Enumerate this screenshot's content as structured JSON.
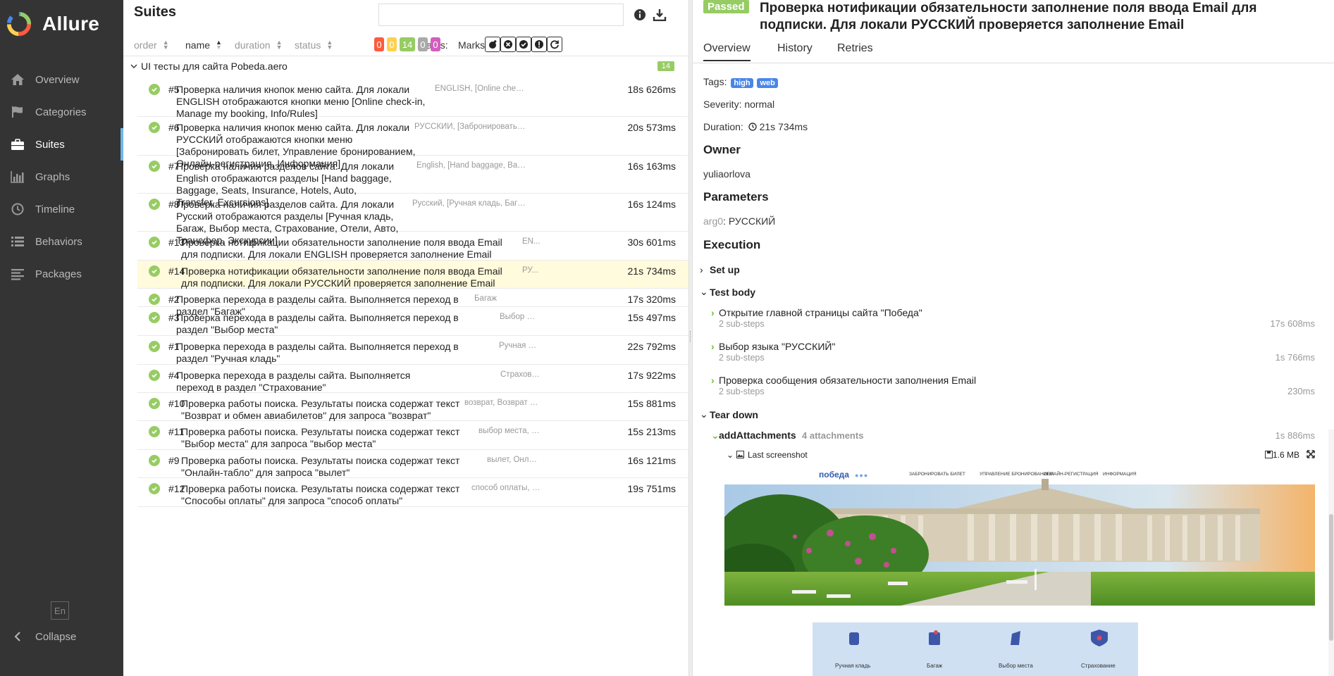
{
  "app": {
    "name": "Allure"
  },
  "sidebar": {
    "items": [
      {
        "label": "Overview",
        "icon": "home-icon"
      },
      {
        "label": "Categories",
        "icon": "flag-icon"
      },
      {
        "label": "Suites",
        "icon": "briefcase-icon",
        "active": true
      },
      {
        "label": "Graphs",
        "icon": "bar-chart-icon"
      },
      {
        "label": "Timeline",
        "icon": "clock-icon"
      },
      {
        "label": "Behaviors",
        "icon": "list-icon"
      },
      {
        "label": "Packages",
        "icon": "align-left-icon"
      }
    ],
    "lang": "En",
    "collapse": "Collapse"
  },
  "suites": {
    "title": "Suites",
    "sort": {
      "order": "order",
      "name": "name",
      "duration": "duration",
      "status": "status"
    },
    "status_label": "Status:",
    "status_counts": [
      {
        "value": "0",
        "color": "#fd5a3e"
      },
      {
        "value": "0",
        "color": "#ffd050"
      },
      {
        "value": "14",
        "color": "#97cc64"
      },
      {
        "value": "0",
        "color": "#aaaaaa"
      },
      {
        "value": "0",
        "color": "#d35ebe"
      }
    ],
    "marks_label": "Marks:",
    "group": {
      "name": "UI тесты для сайта Pobeda.aero",
      "count": "14"
    },
    "tests": [
      {
        "num": "#5",
        "name": "Проверка наличия кнопок меню сайта. Для локали ENGLISH отображаются кнопки меню [Online check-in, Manage my booking, Info/Rules]",
        "params": "ENGLISH, [Online check-in,...",
        "duration": "18s 626ms"
      },
      {
        "num": "#6",
        "name": "Проверка наличия кнопок меню сайта. Для локали РУССКИЙ отображаются кнопки меню [Забронировать билет, Управление бронированием, Онлайн-регистрация, Информация]",
        "params": "РУССКИЙ, [Забронировать биле...",
        "duration": "20s 573ms"
      },
      {
        "num": "#7",
        "name": "Проверка наличия разделов сайта. Для локали English отображаются разделы [Hand baggage, Baggage, Seats, Insurance, Hotels, Auto, Transfer, Excursions]",
        "params": "English, [Hand baggage, Baggag...",
        "duration": "16s 163ms"
      },
      {
        "num": "#8",
        "name": "Проверка наличия разделов сайта. Для локали Русский отображаются разделы [Ручная кладь, Багаж, Выбор места, Страхование, Отели, Авто, Трансфер, Экскурсии]",
        "params": "Русский, [Ручная кладь, Багаж, В...",
        "duration": "16s 124ms"
      },
      {
        "num": "#13",
        "name": "Проверка нотификации обязательности заполнение поля ввода Email для подписки. Для локали ENGLISH проверяется заполнение Email",
        "params": "EN...",
        "duration": "30s 601ms"
      },
      {
        "num": "#14",
        "name": "Проверка нотификации обязательности заполнение поля ввода Email для подписки. Для локали РУССКИЙ проверяется заполнение Email",
        "params": "РУ...",
        "duration": "21s 734ms",
        "selected": true
      },
      {
        "num": "#2",
        "name": "Проверка перехода в разделы сайта. Выполняется переход в раздел \"Багаж\"",
        "params": "Багаж",
        "duration": "17s 320ms"
      },
      {
        "num": "#3",
        "name": "Проверка перехода в разделы сайта. Выполняется переход в раздел \"Выбор места\"",
        "params": "Выбор ме...",
        "duration": "15s 497ms"
      },
      {
        "num": "#1",
        "name": "Проверка перехода в разделы сайта. Выполняется переход в раздел \"Ручная кладь\"",
        "params": "Ручная кла...",
        "duration": "22s 792ms"
      },
      {
        "num": "#4",
        "name": "Проверка перехода в разделы сайта. Выполняется переход в раздел \"Страхование\"",
        "params": "Страхован...",
        "duration": "17s 922ms"
      },
      {
        "num": "#10",
        "name": "Проверка работы поиска. Результаты поиска содержат текст \"Возврат и обмен авиабилетов\" для запроса \"возврат\"",
        "params": "возврат, Возврат и об...",
        "duration": "15s 881ms"
      },
      {
        "num": "#11",
        "name": "Проверка работы поиска. Результаты поиска содержат текст \"Выбор места\" для запроса \"выбор места\"",
        "params": "выбор места, Вы...",
        "duration": "15s 213ms"
      },
      {
        "num": "#9",
        "name": "Проверка работы поиска. Результаты поиска содержат текст \"Онлайн-табло\" для запроса \"вылет\"",
        "params": "вылет, Онлайн...",
        "duration": "16s 121ms"
      },
      {
        "num": "#12",
        "name": "Проверка работы поиска. Результаты поиска содержат текст \"Способы оплаты\" для запроса \"способ оплаты\"",
        "params": "способ оплаты, Спо...",
        "duration": "19s 751ms"
      }
    ]
  },
  "detail": {
    "status": "Passed",
    "title": "Проверка нотификации обязательности заполнение поля ввода Email для подписки. Для локали РУССКИЙ проверяется заполнение Email",
    "tabs": [
      "Overview",
      "History",
      "Retries"
    ],
    "tags_label": "Tags:",
    "tags": [
      "high",
      "web"
    ],
    "severity": "Severity: normal",
    "duration_label": "Duration:",
    "duration": "21s 734ms",
    "owner_heading": "Owner",
    "owner": "yuliaorlova",
    "params_heading": "Parameters",
    "param_key": "arg0",
    "param_value": "РУССКИЙ",
    "execution_heading": "Execution",
    "setup": "Set up",
    "test_body": "Test body",
    "steps": [
      {
        "name": "Открытие главной страницы сайта \"Победа\"",
        "sub": "2 sub-steps",
        "duration": "17s 608ms"
      },
      {
        "name": "Выбор языка \"РУССКИЙ\"",
        "sub": "2 sub-steps",
        "duration": "1s 766ms"
      },
      {
        "name": "Проверка сообщения обязательности заполнения Email",
        "sub": "2 sub-steps",
        "duration": "230ms"
      }
    ],
    "teardown": "Tear down",
    "attach_step": {
      "name": "addAttachments",
      "meta": "4 attachments",
      "duration": "1s 886ms"
    },
    "screenshot": {
      "name": "Last screenshot",
      "size": "1.6 MB"
    },
    "site": {
      "logo": "победа",
      "menu": [
        "ЗАБРОНИРОВАТЬ БИЛЕТ",
        "УПРАВЛЕНИЕ БРОНИРОВАНИЕМ",
        "ОНЛАЙН-РЕГИСТРАЦИЯ",
        "ИНФОРМАЦИЯ"
      ],
      "services": [
        "Ручная кладь",
        "Багаж",
        "Выбор места",
        "Страхование"
      ]
    }
  }
}
